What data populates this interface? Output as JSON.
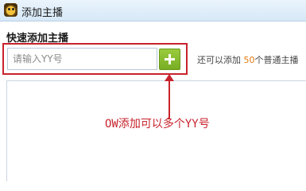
{
  "window": {
    "title": "添加主播",
    "icon": "app-logo-icon"
  },
  "section": {
    "title": "快速添加主播"
  },
  "search": {
    "placeholder": "请输入YY号",
    "value": ""
  },
  "add_button": {
    "icon": "plus-icon",
    "color": "#8cc034"
  },
  "remaining": {
    "prefix": "还可以添加",
    "count": "50",
    "suffix": "个普通主播"
  },
  "annotation": {
    "text": "OW添加可以多个YY号",
    "color": "#c8232c"
  }
}
